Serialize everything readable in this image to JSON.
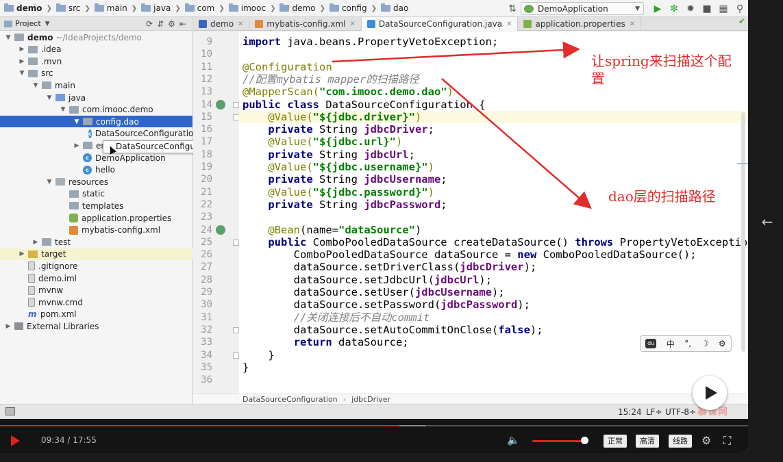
{
  "navbar": {
    "breadcrumbs": [
      "demo",
      "src",
      "main",
      "java",
      "com",
      "imooc",
      "demo",
      "config",
      "dao"
    ],
    "run_config": "DemoApplication"
  },
  "project_panel": {
    "title": "Project",
    "tree": [
      {
        "label": "demo",
        "extra": "~/IdeaProjects/demo",
        "depth": 0,
        "icon": "folder",
        "arrow": "down",
        "bold": true
      },
      {
        "label": ".idea",
        "depth": 1,
        "icon": "folder",
        "arrow": "right"
      },
      {
        "label": ".mvn",
        "depth": 1,
        "icon": "folder",
        "arrow": "right"
      },
      {
        "label": "src",
        "depth": 1,
        "icon": "folder",
        "arrow": "down"
      },
      {
        "label": "main",
        "depth": 2,
        "icon": "folder",
        "arrow": "down"
      },
      {
        "label": "java",
        "depth": 3,
        "icon": "folder-src",
        "arrow": "down"
      },
      {
        "label": "com.imooc.demo",
        "depth": 4,
        "icon": "pkg",
        "arrow": "down"
      },
      {
        "label": "config.dao",
        "depth": 5,
        "icon": "pkg",
        "arrow": "down",
        "selected": true
      },
      {
        "label": "DataSourceConfiguration",
        "depth": 6,
        "icon": "class",
        "arrow": ""
      },
      {
        "label": "entity",
        "depth": 5,
        "icon": "pkg",
        "arrow": "right"
      },
      {
        "label": "DemoApplication",
        "depth": 5,
        "icon": "class",
        "arrow": ""
      },
      {
        "label": "hello",
        "depth": 5,
        "icon": "class",
        "arrow": ""
      },
      {
        "label": "resources",
        "depth": 3,
        "icon": "folder-res",
        "arrow": "down"
      },
      {
        "label": "static",
        "depth": 4,
        "icon": "folder",
        "arrow": ""
      },
      {
        "label": "templates",
        "depth": 4,
        "icon": "folder",
        "arrow": ""
      },
      {
        "label": "application.properties",
        "depth": 4,
        "icon": "prop",
        "arrow": ""
      },
      {
        "label": "mybatis-config.xml",
        "depth": 4,
        "icon": "xml",
        "arrow": ""
      },
      {
        "label": "test",
        "depth": 2,
        "icon": "folder",
        "arrow": "right"
      },
      {
        "label": "target",
        "depth": 1,
        "icon": "folder-target",
        "arrow": "right",
        "target": true
      },
      {
        "label": ".gitignore",
        "depth": 1,
        "icon": "file",
        "arrow": ""
      },
      {
        "label": "demo.iml",
        "depth": 1,
        "icon": "file",
        "arrow": ""
      },
      {
        "label": "mvnw",
        "depth": 1,
        "icon": "file",
        "arrow": ""
      },
      {
        "label": "mvnw.cmd",
        "depth": 1,
        "icon": "file",
        "arrow": ""
      },
      {
        "label": "pom.xml",
        "depth": 1,
        "icon": "maven",
        "arrow": ""
      },
      {
        "label": "External Libraries",
        "depth": 0,
        "icon": "lib",
        "arrow": "right"
      }
    ],
    "popup": "DataSourceConfiguration"
  },
  "tabs": [
    {
      "label": "demo",
      "icon": "maven-icon",
      "color": "#3a63c2",
      "active": false
    },
    {
      "label": "mybatis-config.xml",
      "icon": "xml-icon",
      "color": "#e08a3c",
      "active": false
    },
    {
      "label": "DataSourceConfiguration.java",
      "icon": "class-icon",
      "color": "#3d8ed6",
      "active": true
    },
    {
      "label": "application.properties",
      "icon": "properties-icon",
      "color": "#7fb04a",
      "active": false
    }
  ],
  "editor": {
    "first_line": 9,
    "current_line": 15,
    "gutter_icons": [
      14,
      24
    ],
    "fold_markers": [
      14,
      15,
      25,
      32,
      34
    ],
    "lines": [
      [
        [
          "kw",
          "import "
        ],
        [
          "",
          "java.beans.PropertyVetoException;"
        ]
      ],
      [],
      [
        [
          "ann",
          "@Configuration"
        ]
      ],
      [
        [
          "cmt",
          "//配置mybatis mapper的扫描路径"
        ]
      ],
      [
        [
          "ann",
          "@MapperScan("
        ],
        [
          "str",
          "\"com.imooc.demo.dao\""
        ],
        [
          "ann",
          ")"
        ]
      ],
      [
        [
          "kw",
          "public class "
        ],
        [
          "",
          "DataSourceConfiguration {"
        ]
      ],
      [
        [
          "",
          "    "
        ],
        [
          "ann",
          "@Value("
        ],
        [
          "str",
          "\"${jdbc.driver}\""
        ],
        [
          "ann",
          ")"
        ]
      ],
      [
        [
          "",
          "    "
        ],
        [
          "kw",
          "private "
        ],
        [
          "",
          "String "
        ],
        [
          "fld",
          "jdbcDriver"
        ],
        [
          "",
          ";"
        ]
      ],
      [
        [
          "",
          "    "
        ],
        [
          "ann",
          "@Value("
        ],
        [
          "str",
          "\"${jdbc.url}\""
        ],
        [
          "ann",
          ")"
        ]
      ],
      [
        [
          "",
          "    "
        ],
        [
          "kw",
          "private "
        ],
        [
          "",
          "String "
        ],
        [
          "fld",
          "jdbcUrl"
        ],
        [
          "",
          ";"
        ]
      ],
      [
        [
          "",
          "    "
        ],
        [
          "ann",
          "@Value("
        ],
        [
          "str",
          "\"${jdbc.username}\""
        ],
        [
          "ann",
          ")"
        ]
      ],
      [
        [
          "",
          "    "
        ],
        [
          "kw",
          "private "
        ],
        [
          "",
          "String "
        ],
        [
          "fld",
          "jdbcUsername"
        ],
        [
          "",
          ";"
        ]
      ],
      [
        [
          "",
          "    "
        ],
        [
          "ann",
          "@Value("
        ],
        [
          "str",
          "\"${jdbc.password}\""
        ],
        [
          "ann",
          ")"
        ]
      ],
      [
        [
          "",
          "    "
        ],
        [
          "kw",
          "private "
        ],
        [
          "",
          "String "
        ],
        [
          "fld",
          "jdbcPassword"
        ],
        [
          "",
          ";"
        ]
      ],
      [],
      [
        [
          "",
          "    "
        ],
        [
          "ann",
          "@Bean"
        ],
        [
          "",
          "(name="
        ],
        [
          "str",
          "\"dataSource\""
        ],
        [
          "",
          ")"
        ]
      ],
      [
        [
          "",
          "    "
        ],
        [
          "kw",
          "public "
        ],
        [
          "",
          "ComboPooledDataSource createDataSource() "
        ],
        [
          "kw",
          "throws "
        ],
        [
          "",
          "PropertyVetoException {"
        ]
      ],
      [
        [
          "",
          "        ComboPooledDataSource dataSource = "
        ],
        [
          "kw",
          "new "
        ],
        [
          "",
          "ComboPooledDataSource();"
        ]
      ],
      [
        [
          "",
          "        dataSource.setDriverClass("
        ],
        [
          "fld",
          "jdbcDriver"
        ],
        [
          "",
          ");"
        ]
      ],
      [
        [
          "",
          "        dataSource.setJdbcUrl("
        ],
        [
          "fld",
          "jdbcUrl"
        ],
        [
          "",
          ");"
        ]
      ],
      [
        [
          "",
          "        dataSource.setUser("
        ],
        [
          "fld",
          "jdbcUsername"
        ],
        [
          "",
          ");"
        ]
      ],
      [
        [
          "",
          "        dataSource.setPassword("
        ],
        [
          "fld",
          "jdbcPassword"
        ],
        [
          "",
          ");"
        ]
      ],
      [
        [
          "",
          "        "
        ],
        [
          "cmt",
          "//关闭连接后不自动commit"
        ]
      ],
      [
        [
          "",
          "        dataSource.setAutoCommitOnClose("
        ],
        [
          "kw",
          "false"
        ],
        [
          "",
          ");"
        ]
      ],
      [
        [
          "",
          "        "
        ],
        [
          "kw",
          "return "
        ],
        [
          "",
          "dataSource;"
        ]
      ],
      [
        [
          "",
          "    }"
        ]
      ],
      [
        [
          "",
          "}"
        ]
      ],
      []
    ]
  },
  "editor_breadcrumb": [
    "DataSourceConfiguration",
    "jdbcDriver"
  ],
  "annotations": {
    "note1": "让spring来扫描这个配置",
    "note2": "dao层的扫描路径",
    "color": "#e22b2b"
  },
  "ime_toolbar": {
    "items": [
      "中",
      "°,",
      "☽",
      "⚙"
    ]
  },
  "statusbar": {
    "position": "15:24",
    "line_sep": "LF÷",
    "encoding": "UTF-8÷",
    "watermark": "慕课网"
  },
  "video": {
    "current_time": "09:34",
    "duration": "17:55",
    "progress": 0.534,
    "buffered": 0.57,
    "volume": 0.95,
    "buttons": [
      "正常",
      "高清",
      "线路"
    ]
  }
}
